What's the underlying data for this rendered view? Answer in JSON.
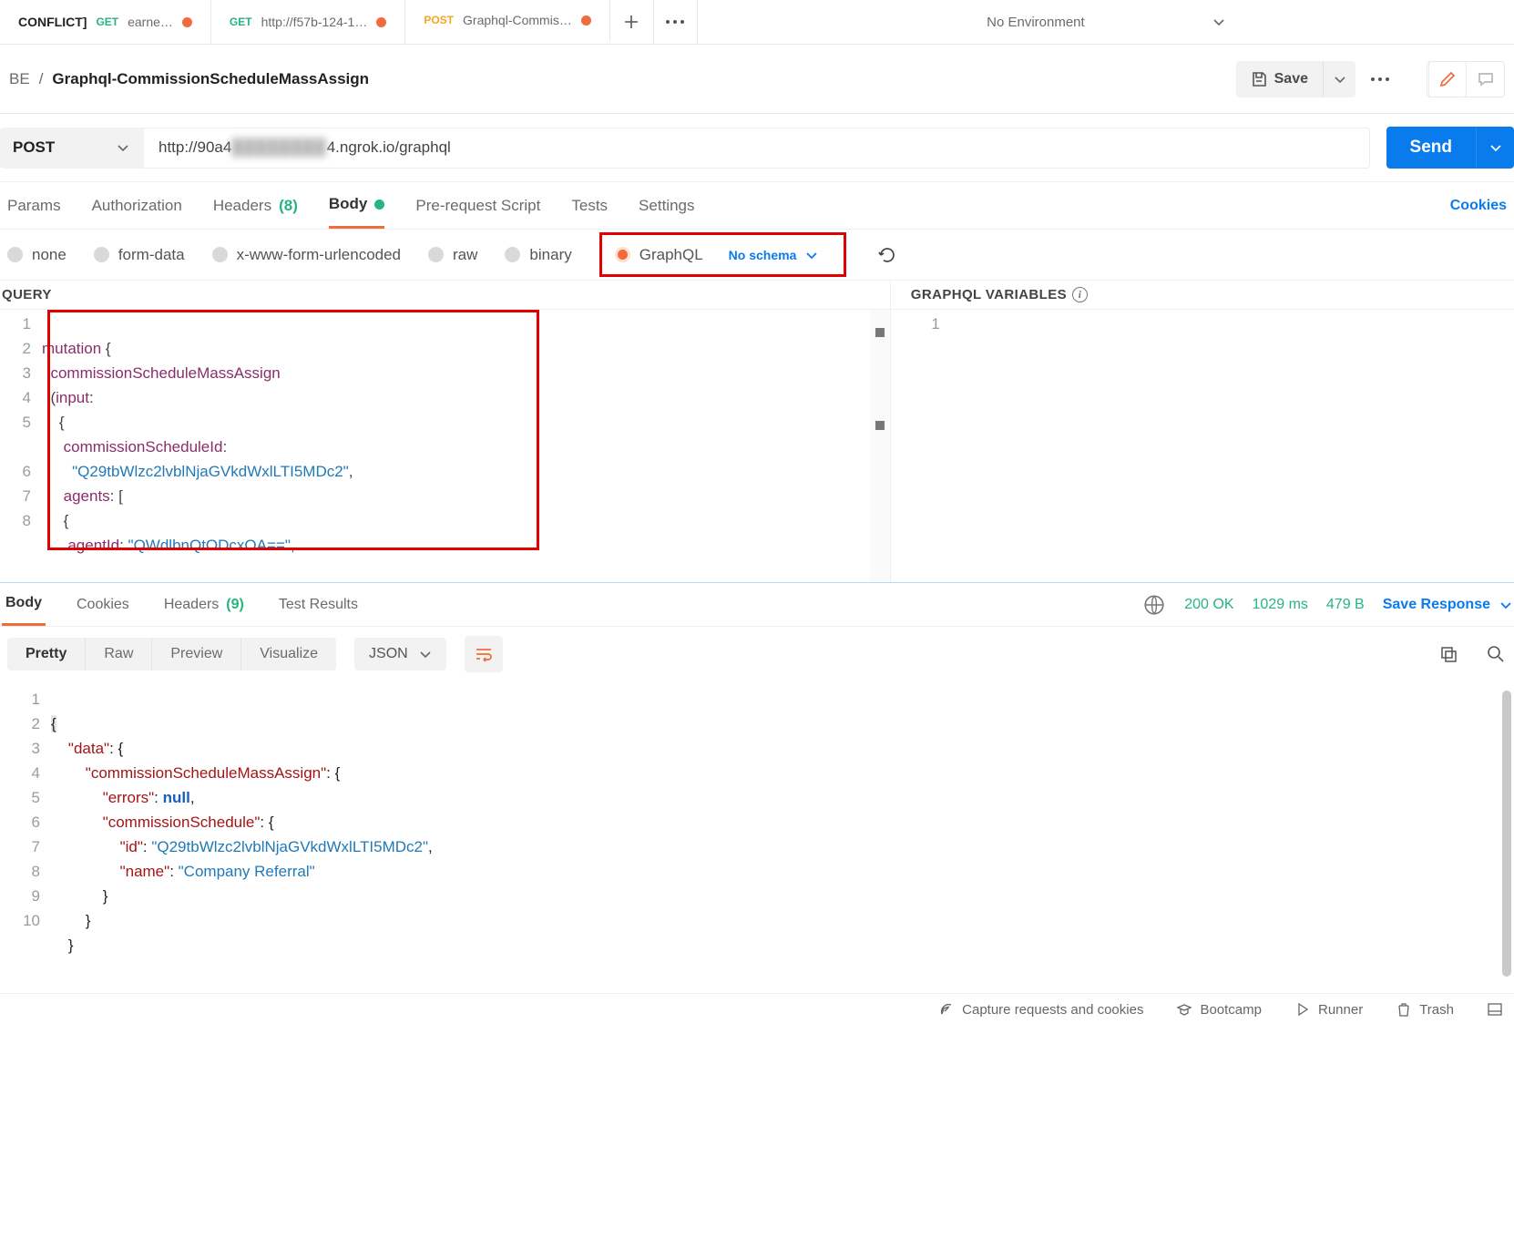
{
  "topTabs": [
    {
      "prefix": "CONFLICT]",
      "method": "GET",
      "label": "earne…",
      "dot": true
    },
    {
      "method": "GET",
      "label": "http://f57b-124-1…",
      "dot": true
    },
    {
      "method": "POST",
      "label": "Graphql-Commis…",
      "dot": true,
      "active": true
    }
  ],
  "environment": "No Environment",
  "breadcrumb": {
    "root": "BE",
    "sep": "/",
    "current": "Graphql-CommissionScheduleMassAssign"
  },
  "saveLabel": "Save",
  "method": "POST",
  "url": {
    "pre": "http://90a4",
    "obscured": "████████",
    "suf": "4.ngrok.io/graphql"
  },
  "sendLabel": "Send",
  "reqTabs": [
    {
      "label": "Params"
    },
    {
      "label": "Authorization"
    },
    {
      "label": "Headers",
      "count": "(8)"
    },
    {
      "label": "Body",
      "dot": true,
      "active": true
    },
    {
      "label": "Pre-request Script"
    },
    {
      "label": "Tests"
    },
    {
      "label": "Settings"
    }
  ],
  "cookiesLink": "Cookies",
  "bodyTypes": [
    {
      "label": "none"
    },
    {
      "label": "form-data"
    },
    {
      "label": "x-www-form-urlencoded"
    },
    {
      "label": "raw"
    },
    {
      "label": "binary"
    }
  ],
  "graphqlLabel": "GraphQL",
  "noSchema": "No schema",
  "queryHeader": "QUERY",
  "varsHeader": "GRAPHQL VARIABLES",
  "queryGutter": [
    "1",
    "2",
    "3",
    "4",
    "5",
    "",
    "6",
    "7",
    "8"
  ],
  "querySegments": {
    "mutation": "mutation",
    "openBr": " {",
    "pad2": "  ",
    "fn": "commissionScheduleMassAssign",
    "openParen": "  (",
    "input": "input",
    "colon": ":",
    "pad4": "    ",
    "braceOpen": "{",
    "pad5": "     ",
    "csid": "commissionScheduleId",
    "colon2": ": ",
    "pad7": "       ",
    "csidVal": "\"Q29tbWlzc2lvblNjaGVkdWxlLTI5MDc2\"",
    "comma": ",",
    "agents": "agents",
    "colonArr": ": [",
    "pad5b": "     ",
    "openBr2": "{",
    "pad6": "      ",
    "agentId": "agentId",
    "colon3": ": ",
    "aidVal": "\"QWdlbnQtODcxOA==\"",
    "comma2": ","
  },
  "varsGutter": [
    "1"
  ],
  "respTabs": [
    {
      "label": "Body",
      "active": true
    },
    {
      "label": "Cookies"
    },
    {
      "label": "Headers",
      "count": "(9)"
    },
    {
      "label": "Test Results"
    }
  ],
  "status": {
    "code": "200",
    "text": "OK",
    "time": "1029 ms",
    "size": "479 B"
  },
  "saveResponse": "Save Response",
  "viewSegments": [
    "Pretty",
    "Raw",
    "Preview",
    "Visualize"
  ],
  "formatSel": "JSON",
  "respGutter": [
    "1",
    "2",
    "3",
    "4",
    "5",
    "6",
    "7",
    "8",
    "9",
    "10"
  ],
  "respSegments": {
    "openBr": "{",
    "pad4": "    ",
    "pad8": "        ",
    "pad12": "            ",
    "pad16": "                ",
    "dataKey": "\"data\"",
    "colonBr": ": {",
    "csmaKey": "\"commissionScheduleMassAssign\"",
    "errorsKey": "\"errors\"",
    "colon": ": ",
    "null": "null",
    "comma": ",",
    "csKey": "\"commissionSchedule\"",
    "idKey": "\"id\"",
    "idVal": "\"Q29tbWlzc2lvblNjaGVkdWxlLTI5MDc2\"",
    "nameKey": "\"name\"",
    "nameVal": "\"Company Referral\"",
    "closeBr": "}"
  },
  "footer": {
    "capture": "Capture requests and cookies",
    "bootcamp": "Bootcamp",
    "runner": "Runner",
    "trash": "Trash"
  }
}
